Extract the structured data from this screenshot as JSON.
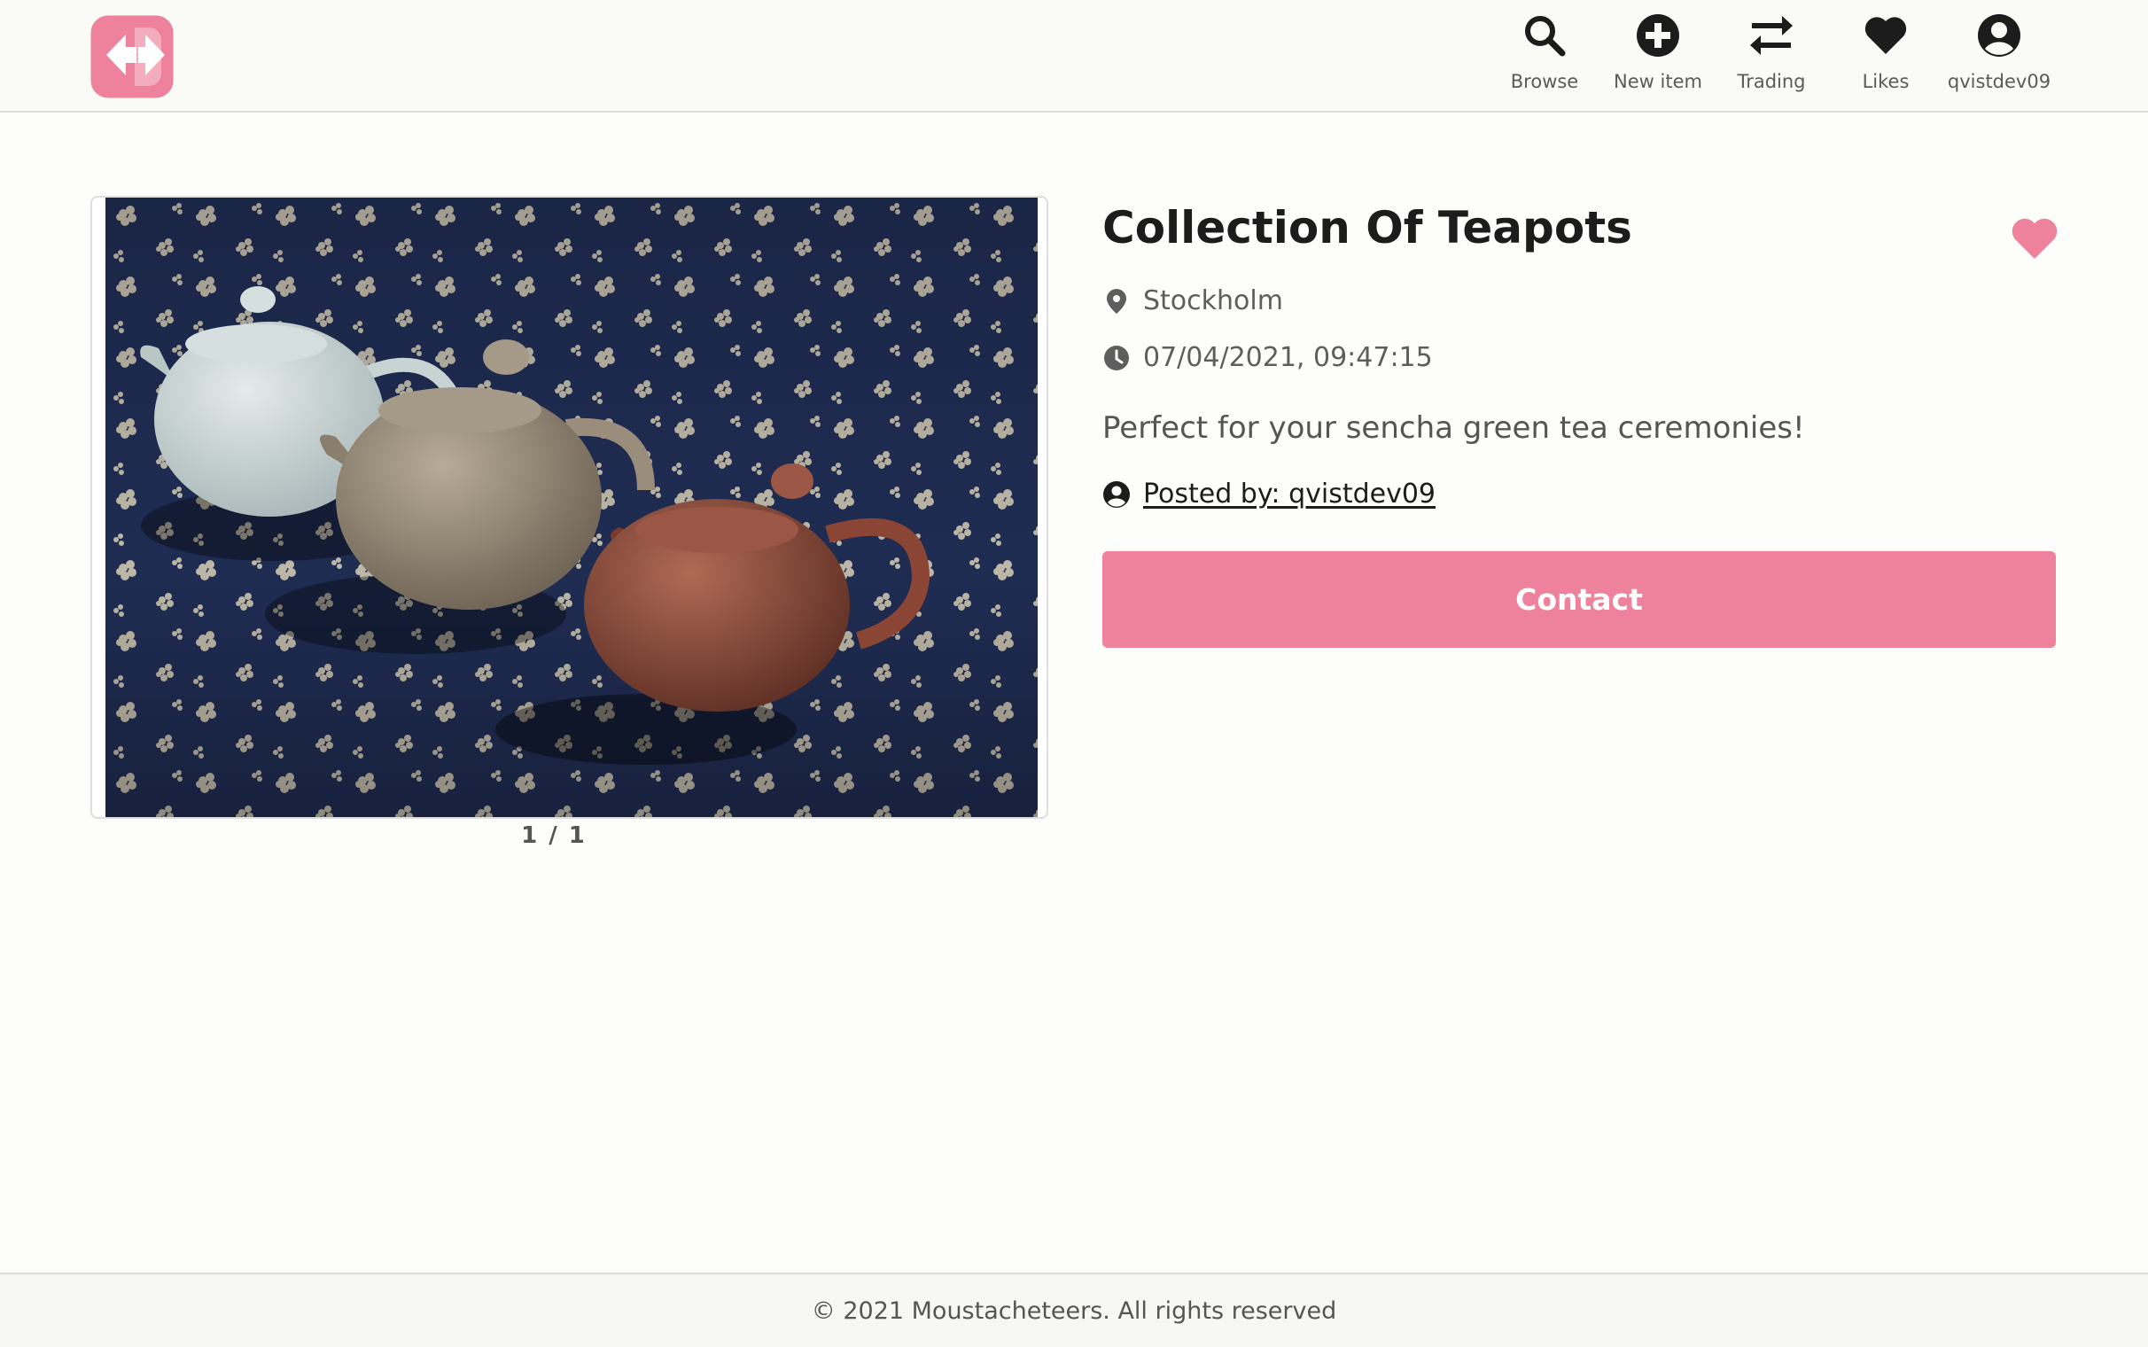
{
  "header": {
    "logo_name": "app-logo",
    "nav": [
      {
        "label": "Browse",
        "icon": "search-icon"
      },
      {
        "label": "New item",
        "icon": "plus-circle-icon"
      },
      {
        "label": "Trading",
        "icon": "swap-arrows-icon"
      },
      {
        "label": "Likes",
        "icon": "heart-icon"
      },
      {
        "label": "qvistdev09",
        "icon": "user-circle-icon"
      }
    ]
  },
  "item": {
    "title": "Collection Of Teapots",
    "location": "Stockholm",
    "timestamp": "07/04/2021, 09:47:15",
    "description": "Perfect for your sencha green tea ceremonies!",
    "posted_by": "Posted by: qvistdev09",
    "image_counter": "1 / 1",
    "liked": true
  },
  "actions": {
    "contact_label": "Contact"
  },
  "footer": {
    "text": "© 2021 Moustacheteers. All rights reserved"
  },
  "colors": {
    "accent": "#ee829c",
    "text_dark": "#1c1c1c",
    "text_muted": "#5e5e5e",
    "photo_background": "#1f2c52"
  }
}
